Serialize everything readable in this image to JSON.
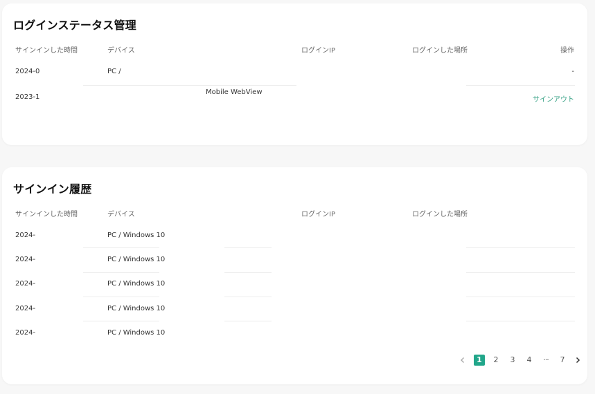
{
  "login_status": {
    "title": "ログインステータス管理",
    "columns": {
      "signin_time": "サインインした時間",
      "device": "デバイス",
      "ip": "ログインIP",
      "location": "ログインした場所",
      "action": "操作"
    },
    "rows": [
      {
        "time": "2024-0",
        "device": "PC /",
        "device_extra": "",
        "action": "-"
      },
      {
        "time": "2023-1",
        "device": "",
        "device_extra": "Mobile WebView",
        "action": "サインアウト"
      }
    ]
  },
  "signin_history": {
    "title": "サインイン履歴",
    "columns": {
      "signin_time": "サインインした時間",
      "device": "デバイス",
      "ip": "ログインIP",
      "location": "ログインした場所"
    },
    "rows": [
      {
        "time": "2024-",
        "device": "PC / Windows 10"
      },
      {
        "time": "2024-",
        "device": "PC / Windows 10"
      },
      {
        "time": "2024-",
        "device": "PC / Windows 10"
      },
      {
        "time": "2024-",
        "device": "PC / Windows 10"
      },
      {
        "time": "2024-",
        "device": "PC / Windows 10"
      }
    ],
    "pagination": {
      "prev_icon": "chevron-left-icon",
      "pages": [
        "1",
        "2",
        "3",
        "4"
      ],
      "ellipsis": "···",
      "last": "7",
      "next_icon": "chevron-right-icon",
      "current": "1"
    }
  },
  "colors": {
    "accent": "#21a68a",
    "signout_link": "#3aa387"
  }
}
